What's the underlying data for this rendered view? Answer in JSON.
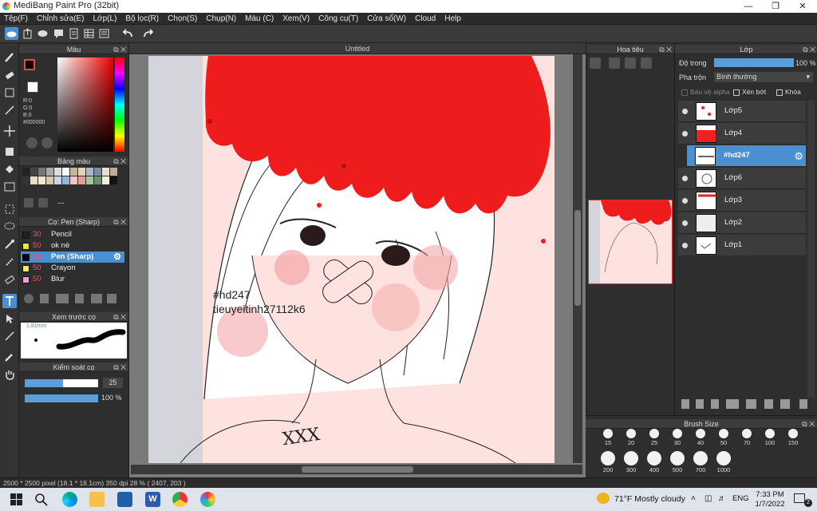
{
  "window": {
    "title": "MediBang Paint Pro (32bit)"
  },
  "menu": [
    "Tệp(F)",
    "Chỉnh sửa(E)",
    "Lớp(L)",
    "Bộ lọc(R)",
    "Chọn(S)",
    "Chụp(N)",
    "Màu (C)",
    "Xem(V)",
    "Công cụ(T)",
    "Cửa sổ(W)",
    "Cloud",
    "Help"
  ],
  "panels": {
    "color": {
      "title": "Màu",
      "r": "R:0",
      "g": "G:0",
      "b": "B:0",
      "hex": "#000000"
    },
    "palette": {
      "title": "Bảng màu",
      "extra": "---"
    },
    "brush": {
      "title": "Cọ: Pen (Sharp)",
      "items": [
        {
          "size": "30",
          "name": "Pencil",
          "color": "#1f1f1f"
        },
        {
          "size": "50",
          "name": "ok nè",
          "color": "#f2e23a"
        },
        {
          "size": "25",
          "name": "Pen (Sharp)",
          "color": "#000000"
        },
        {
          "size": "50",
          "name": "Crayon",
          "color": "#f4e86a"
        },
        {
          "size": "50",
          "name": "Blur",
          "color": "#f39be0"
        }
      ]
    },
    "preview": {
      "title": "Xem trước cọ",
      "size": "1.81mm"
    },
    "control": {
      "title": "Kiểm soát cọ",
      "size_value": "25",
      "opacity_value": "100 %"
    },
    "navigator": {
      "title": "Hoa tiêu"
    },
    "layers": {
      "title": "Lớp",
      "opacity_label": "Độ trong",
      "opacity_value": "100 %",
      "blend_label": "Pha trộn",
      "blend_value": "Bình thường",
      "protect_alpha": "Bảo vệ alpha",
      "clipping": "Xén bớt",
      "lock": "Khóa",
      "items": [
        "Lớp5",
        "Lớp4",
        "#hd247",
        "Lớp6",
        "Lớp3",
        "Lớp2",
        "Lớp1"
      ],
      "selected": "#hd247"
    },
    "brush_size": {
      "title": "Brush Size",
      "row1": [
        "15",
        "20",
        "25",
        "30",
        "40",
        "50",
        "70",
        "100",
        "150"
      ],
      "row2": [
        "200",
        "300",
        "400",
        "500",
        "700",
        "1000"
      ]
    }
  },
  "canvas": {
    "tab": "Untitled",
    "text1": "#hd247",
    "text2": "tieuyeitinh27112k6",
    "text3": "XXX"
  },
  "status": {
    "text": "2500 * 2500 pixel  (18.1 * 18.1cm)  350 dpi  28 %  ( 2407, 203 )"
  },
  "taskbar": {
    "weather": "71°F  Mostly cloudy",
    "lang": "ENG",
    "time": "7:33 PM",
    "date": "1/7/2022",
    "notifications": "2"
  },
  "colors": {
    "accent": "#4a8fd0",
    "paint": "#ee1c1c",
    "skin": "#fde2df"
  }
}
